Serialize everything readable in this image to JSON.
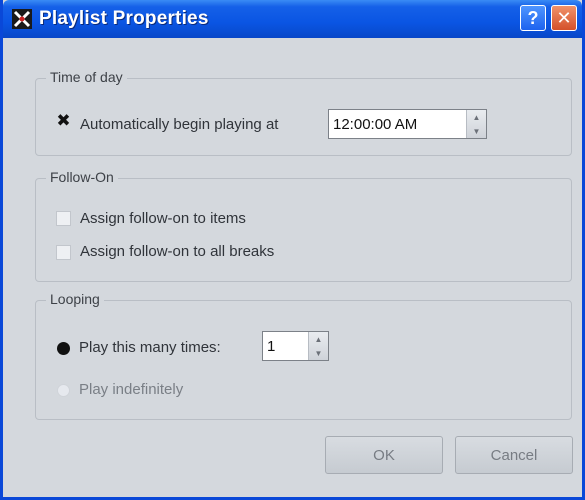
{
  "window": {
    "title": "Playlist Properties",
    "help_label": "?",
    "close_label": "✕"
  },
  "time_of_day": {
    "legend": "Time of day",
    "auto_begin_label": "Automatically begin playing at",
    "auto_begin_checked": true,
    "time_value": "12:00:00 AM"
  },
  "follow_on": {
    "legend": "Follow-On",
    "assign_items_label": "Assign follow-on to items",
    "assign_items_checked": false,
    "assign_breaks_label": "Assign follow-on to all breaks",
    "assign_breaks_checked": false
  },
  "looping": {
    "legend": "Looping",
    "play_times_label": "Play this many times:",
    "play_times_selected": true,
    "times_value": "1",
    "play_indefinitely_label": "Play indefinitely",
    "play_indefinitely_selected": false
  },
  "buttons": {
    "ok_label": "OK",
    "cancel_label": "Cancel"
  },
  "colors": {
    "titlebar": "#0a55e3",
    "dialog_bg": "#d4d8dd"
  }
}
